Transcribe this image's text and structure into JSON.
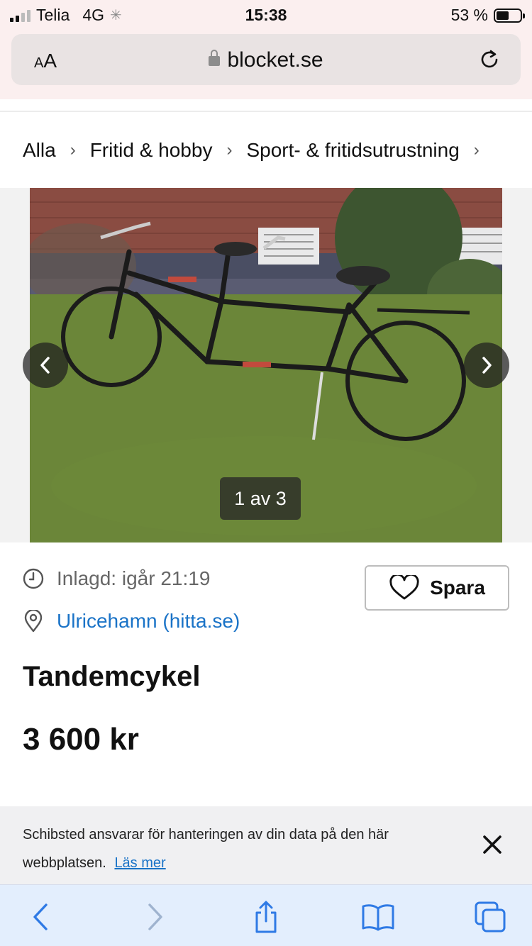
{
  "status_bar": {
    "carrier": "Telia",
    "network": "4G",
    "time": "15:38",
    "battery": "53 %"
  },
  "browser": {
    "text_size_label": "AA",
    "domain": "blocket.se"
  },
  "breadcrumb": [
    "Alla",
    "Fritid & hobby",
    "Sport- & fritidsutrustning"
  ],
  "gallery": {
    "counter": "1 av 3"
  },
  "listing": {
    "posted": "Inlagd: igår 21:19",
    "location": "Ulricehamn (hitta.se)",
    "save_label": "Spara",
    "title": "Tandemcykel",
    "price": "3 600 kr"
  },
  "consent": {
    "text": "Schibsted ansvarar för hanteringen av din data på den här webbplatsen.",
    "link": "Läs mer"
  },
  "colors": {
    "accent_link": "#1a73c7",
    "toolbar_icons": "#2f7ae5",
    "status_bg": "#fbefef"
  },
  "icons": [
    "signal-icon",
    "battery-icon",
    "lock-icon",
    "reload-icon",
    "chevron-left-icon",
    "chevron-right-icon",
    "clock-icon",
    "location-pin-icon",
    "heart-icon",
    "close-icon",
    "share-icon",
    "bookmarks-icon",
    "tabs-icon"
  ]
}
